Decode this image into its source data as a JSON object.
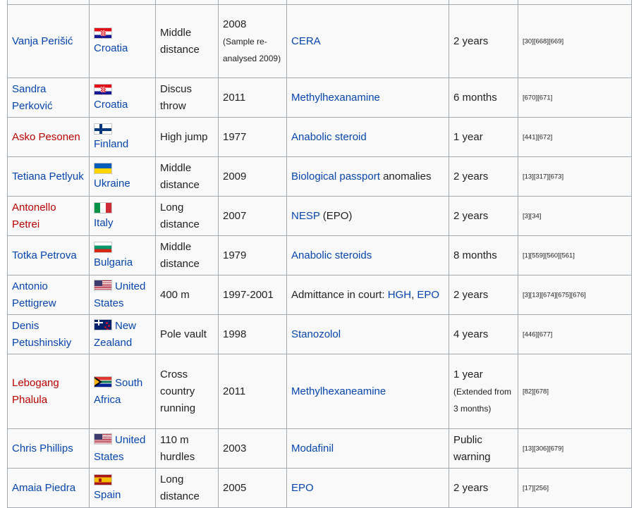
{
  "rows": [
    {
      "athlete": "Vanja Perišić",
      "athlete_red": false,
      "flag": "croatia-flag",
      "country_line1": "Croatia",
      "country_line2": "",
      "event_line1": "Middle",
      "event_line2": "distance",
      "event_line3": "",
      "year_main": "2008",
      "year_note": "(Sample re-analysed 2009)",
      "substance_link": "CERA",
      "substance_link2": "",
      "substance_text": "",
      "substance_prefix": "",
      "ban_main": "2 years",
      "ban_note": "",
      "refs": "[30][668][669]"
    },
    {
      "athlete": "Sandra Perković",
      "athlete_red": false,
      "flag": "croatia-flag",
      "country_line1": "Croatia",
      "country_line2": "",
      "event_line1": "Discus",
      "event_line2": "throw",
      "event_line3": "",
      "year_main": "2011",
      "year_note": "",
      "substance_link": "Methylhexanamine",
      "substance_link2": "",
      "substance_text": "",
      "substance_prefix": "",
      "ban_main": "6 months",
      "ban_note": "",
      "refs": "[670][671]"
    },
    {
      "athlete": "Asko Pesonen",
      "athlete_red": true,
      "flag": "finland-flag",
      "country_line1": "Finland",
      "country_line2": "",
      "event_line1": "High jump",
      "event_line2": "",
      "event_line3": "",
      "year_main": "1977",
      "year_note": "",
      "substance_link": "Anabolic steroid",
      "substance_link2": "",
      "substance_text": "",
      "substance_prefix": "",
      "ban_main": "1 year",
      "ban_note": "",
      "refs": "[441][672]"
    },
    {
      "athlete": "Tetiana Petlyuk",
      "athlete_red": false,
      "flag": "ukraine-flag",
      "country_line1": "Ukraine",
      "country_line2": "",
      "event_line1": "Middle",
      "event_line2": "distance",
      "event_line3": "",
      "year_main": "2009",
      "year_note": "",
      "substance_link": "Biological passport",
      "substance_link2": "",
      "substance_text": " anomalies",
      "substance_prefix": "",
      "ban_main": "2 years",
      "ban_note": "",
      "refs": "[13][317][673]"
    },
    {
      "athlete": "Antonello Petrei",
      "athlete_red": true,
      "flag": "italy-flag",
      "country_line1": "Italy",
      "country_line2": "",
      "event_line1": "Long",
      "event_line2": "distance",
      "event_line3": "",
      "year_main": "2007",
      "year_note": "",
      "substance_link": "NESP",
      "substance_link2": "",
      "substance_text": " (EPO)",
      "substance_prefix": "",
      "ban_main": "2 years",
      "ban_note": "",
      "refs": "[3][34]"
    },
    {
      "athlete": "Totka Petrova",
      "athlete_red": false,
      "flag": "bulgaria-flag",
      "country_line1": "Bulgaria",
      "country_line2": "",
      "event_line1": "Middle",
      "event_line2": "distance",
      "event_line3": "",
      "year_main": "1979",
      "year_note": "",
      "substance_link": "Anabolic steroids",
      "substance_link2": "",
      "substance_text": "",
      "substance_prefix": "",
      "ban_main": "8 months",
      "ban_note": "",
      "refs": "[1][559][560][561]"
    },
    {
      "athlete": "Antonio Pettigrew",
      "athlete_red": false,
      "flag": "united-states-flag",
      "country_line1": "United",
      "country_line2": "States",
      "event_line1": "400 m",
      "event_line2": "",
      "event_line3": "",
      "year_main": "1997-2001",
      "year_note": "",
      "substance_link": "HGH",
      "substance_link2": "EPO",
      "substance_text": "",
      "substance_prefix": "Admittance in court: ",
      "ban_main": "2 years",
      "ban_note": "",
      "refs": "[3][13][674][675][676]"
    },
    {
      "athlete": "Denis Petushinskiy",
      "athlete_red": false,
      "flag": "new-zealand-flag",
      "country_line1": "New",
      "country_line2": "Zealand",
      "event_line1": "Pole vault",
      "event_line2": "",
      "event_line3": "",
      "year_main": "1998",
      "year_note": "",
      "substance_link": "Stanozolol",
      "substance_link2": "",
      "substance_text": "",
      "substance_prefix": "",
      "ban_main": "4 years",
      "ban_note": "",
      "refs": "[446][677]"
    },
    {
      "athlete": "Lebogang Phalula",
      "athlete_red": true,
      "flag": "south-africa-flag",
      "country_line1": "South",
      "country_line2": "Africa",
      "event_line1": "Cross",
      "event_line2": "country",
      "event_line3": "running",
      "year_main": "2011",
      "year_note": "",
      "substance_link": "Methylhexaneamine",
      "substance_link2": "",
      "substance_text": "",
      "substance_prefix": "",
      "ban_main": "1 year",
      "ban_note": "(Extended from 3 months)",
      "refs": "[82][678]"
    },
    {
      "athlete": "Chris Phillips",
      "athlete_red": false,
      "flag": "united-states-flag",
      "country_line1": "United",
      "country_line2": "States",
      "event_line1": "110 m",
      "event_line2": "hurdles",
      "event_line3": "",
      "year_main": "2003",
      "year_note": "",
      "substance_link": "Modafinil",
      "substance_link2": "",
      "substance_text": "",
      "substance_prefix": "",
      "ban_main": "Public warning",
      "ban_note": "",
      "refs": "[13][306][679]"
    },
    {
      "athlete": "Amaia Piedra",
      "athlete_red": false,
      "flag": "spain-flag",
      "country_line1": "Spain",
      "country_line2": "",
      "event_line1": "Long",
      "event_line2": "distance",
      "event_line3": "",
      "year_main": "2005",
      "year_note": "",
      "substance_link": "EPO",
      "substance_link2": "",
      "substance_text": "",
      "substance_prefix": "",
      "ban_main": "2 years",
      "ban_note": "",
      "refs": "[17][256]"
    }
  ],
  "colors": {
    "link": "#0645ad",
    "redlink": "#ba0000",
    "border": "#a2a9b1",
    "cell_bg": "#f9f9f9"
  }
}
